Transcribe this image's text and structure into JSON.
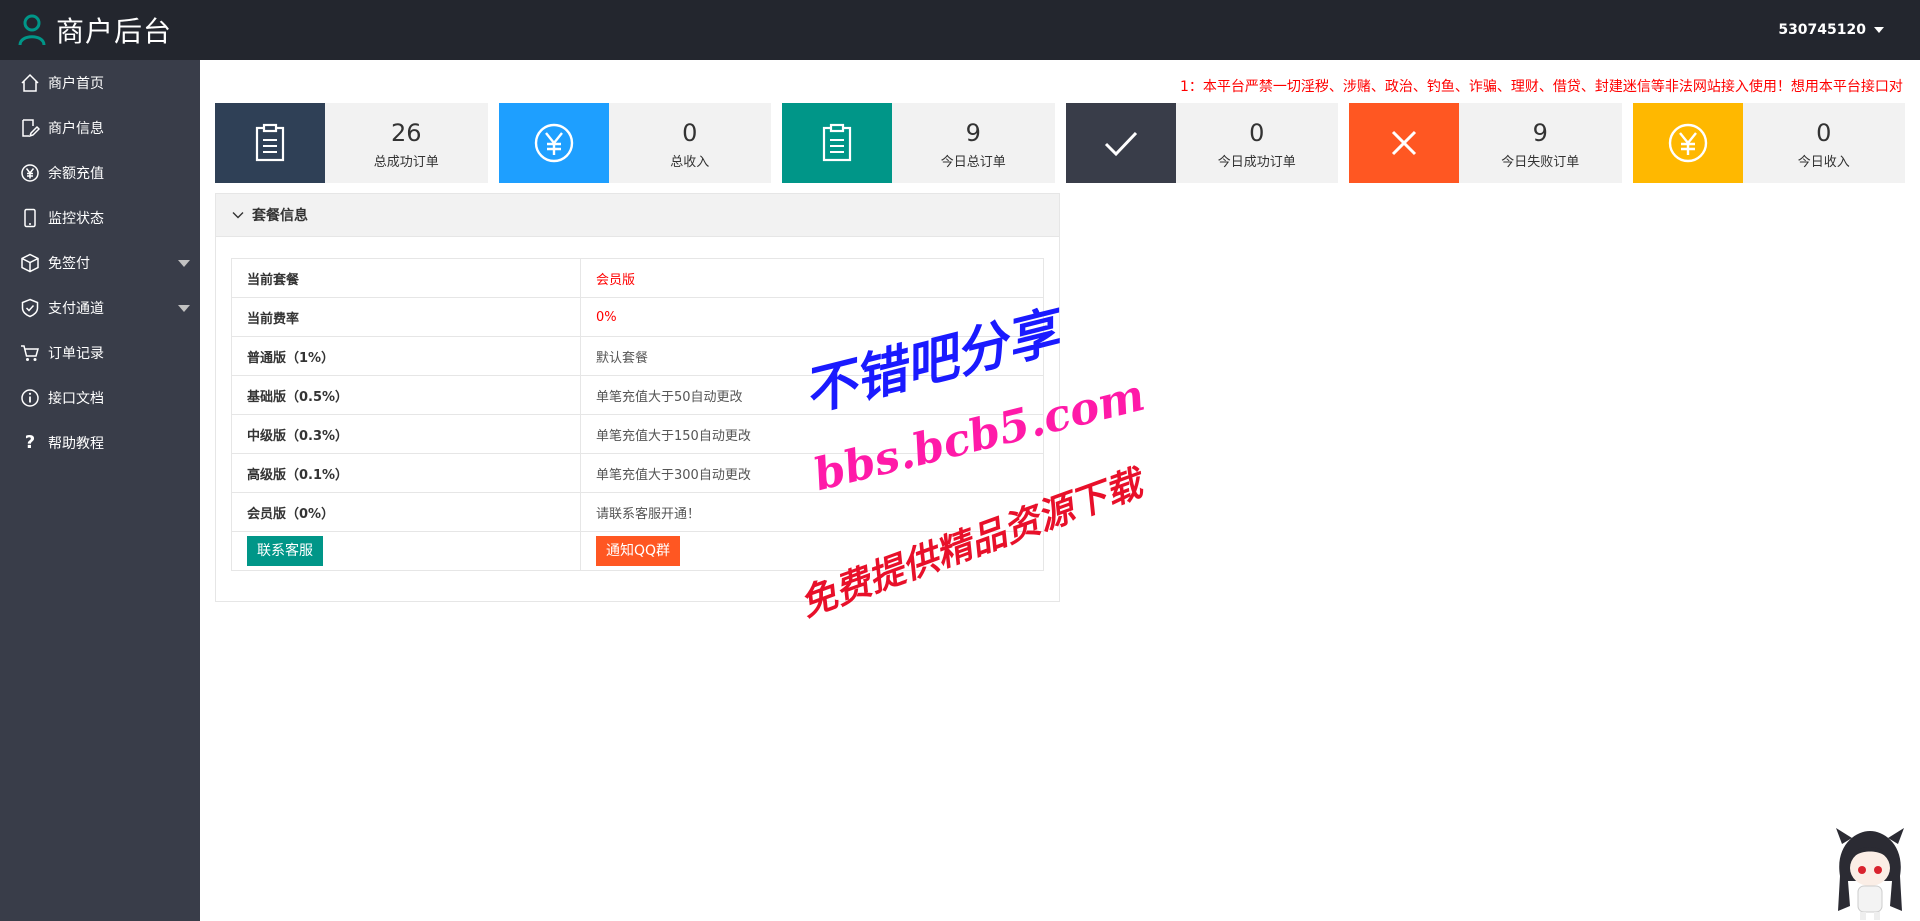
{
  "header": {
    "title": "商户后台",
    "user": "530745120"
  },
  "sidebar": {
    "items": [
      {
        "label": "商户首页",
        "icon": "home-icon"
      },
      {
        "label": "商户信息",
        "icon": "edit-icon"
      },
      {
        "label": "余额充值",
        "icon": "yen-icon"
      },
      {
        "label": "监控状态",
        "icon": "phone-icon"
      },
      {
        "label": "免签付",
        "icon": "box-icon"
      },
      {
        "label": "支付通道",
        "icon": "shield-icon"
      },
      {
        "label": "订单记录",
        "icon": "cart-icon"
      },
      {
        "label": "接口文档",
        "icon": "info-icon"
      },
      {
        "label": "帮助教程",
        "icon": "help-icon",
        "glyph": "?"
      }
    ]
  },
  "notice": "1：本平台严禁一切淫秽、涉赌、政治、钓鱼、诈骗、理财、借贷、封建迷信等非法网站接入使用！想用本平台接口对",
  "stats": [
    {
      "value": "26",
      "label": "总成功订单",
      "color": "#2f4056",
      "icon": "clipboard-icon"
    },
    {
      "value": "0",
      "label": "总收入",
      "color": "#1e9fff",
      "icon": "yen-circle-icon"
    },
    {
      "value": "9",
      "label": "今日总订单",
      "color": "#009688",
      "icon": "clipboard-icon"
    },
    {
      "value": "0",
      "label": "今日成功订单",
      "color": "#393d49",
      "icon": "check-icon"
    },
    {
      "value": "9",
      "label": "今日失败订单",
      "color": "#ff5722",
      "icon": "close-icon"
    },
    {
      "value": "0",
      "label": "今日收入",
      "color": "#ffb800",
      "icon": "yen-circle-icon"
    }
  ],
  "panel": {
    "title": "套餐信息",
    "rows": [
      {
        "key": "当前套餐",
        "value": "会员版"
      },
      {
        "key": "当前费率",
        "value": "0%"
      },
      {
        "key": "普通版（1%）",
        "value": "默认套餐"
      },
      {
        "key": "基础版（0.5%）",
        "value": "单笔充值大于50自动更改"
      },
      {
        "key": "中级版（0.3%）",
        "value": "单笔充值大于150自动更改"
      },
      {
        "key": "高级版（0.1%）",
        "value": "单笔充值大于300自动更改"
      },
      {
        "key": "会员版（0%）",
        "value": "请联系客服开通！"
      }
    ],
    "contact_button": "联系客服",
    "qq_button": "通知QQ群"
  },
  "watermark": {
    "line1": "不错吧分享",
    "line2": "bbs.bcb5.com",
    "line3": "免费提供精品资源下载"
  },
  "colors": {
    "header_bg": "#23262e",
    "sidebar_bg": "#393d49",
    "logo_accent": "#009688",
    "notice_red": "#ff0000",
    "button_green": "#009688",
    "button_orange": "#ff5722"
  }
}
